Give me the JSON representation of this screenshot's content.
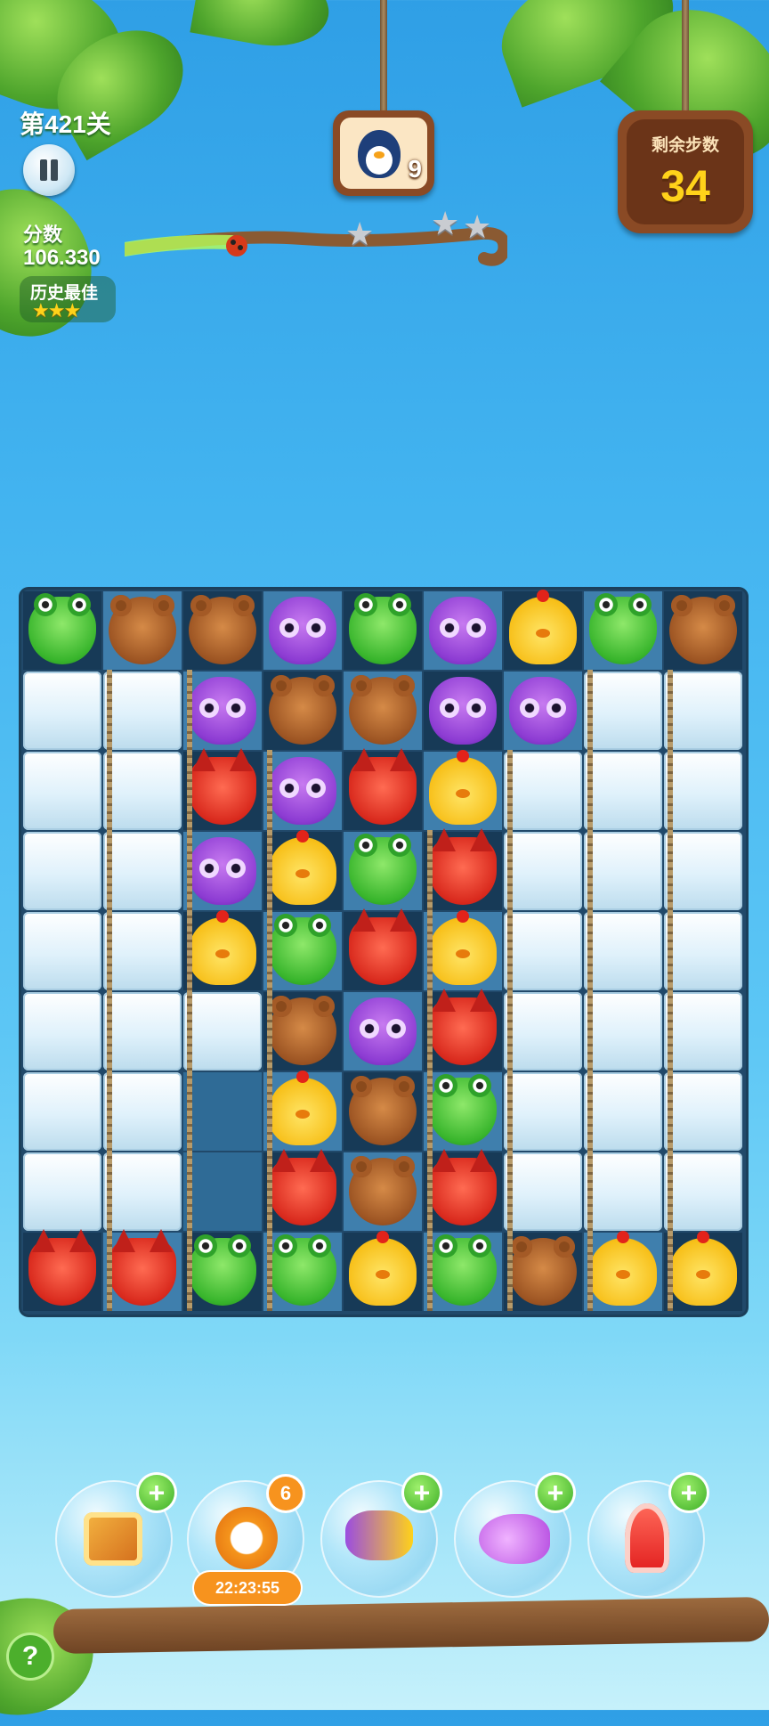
{
  "hud": {
    "level_label": "第421关",
    "score_label": "分数",
    "score_value": "106.330",
    "best_label": "历史最佳",
    "best_stars": "★★★",
    "target_count": "9",
    "moves_label": "剩余步数",
    "moves_value": "34",
    "progress_stars": "★",
    "progress_stars_count": 3
  },
  "board": {
    "rows": [
      [
        "frog",
        "bear",
        "bear",
        "owl",
        "frog",
        "owl",
        "chick",
        "frog",
        "bear"
      ],
      [
        "ice",
        "ice",
        "owl",
        "bear",
        "bear",
        "owl",
        "owl",
        "ice",
        "ice"
      ],
      [
        "ice",
        "ice",
        "fox",
        "owl",
        "fox",
        "chick",
        "ice",
        "ice",
        "ice"
      ],
      [
        "ice",
        "ice",
        "owl",
        "chick",
        "frog",
        "fox",
        "ice",
        "ice",
        "ice"
      ],
      [
        "ice",
        "ice",
        "chick",
        "frog",
        "fox",
        "chick",
        "ice",
        "ice",
        "ice"
      ],
      [
        "ice",
        "ice",
        "ice",
        "bear",
        "owl",
        "fox",
        "ice",
        "ice",
        "ice"
      ],
      [
        "ice",
        "ice",
        "empty",
        "chick",
        "bear",
        "frog",
        "ice",
        "ice",
        "ice"
      ],
      [
        "ice",
        "ice",
        "empty",
        "fox",
        "bear",
        "fox",
        "ice",
        "ice",
        "ice"
      ],
      [
        "fox",
        "fox",
        "frog",
        "frog",
        "chick",
        "frog",
        "bear",
        "chick",
        "chick"
      ]
    ]
  },
  "boosters": [
    {
      "name": "shuffle-booster",
      "icon": "shuffle-board-icon",
      "plus": "+"
    },
    {
      "name": "time-booster",
      "icon": "clock-refresh-icon",
      "badge": "6",
      "timer": "22:23:55"
    },
    {
      "name": "swap-booster",
      "icon": "swap-pieces-icon",
      "plus": "+"
    },
    {
      "name": "line-booster",
      "icon": "fish-arrow-icon",
      "plus": "+"
    },
    {
      "name": "rocket-booster",
      "icon": "rocket-icon",
      "plus": "+"
    }
  ],
  "help_label": "?",
  "colors": {
    "accent_orange": "#f7931e",
    "board_bg": "#21496a",
    "moves_yellow": "#ffd21a"
  }
}
